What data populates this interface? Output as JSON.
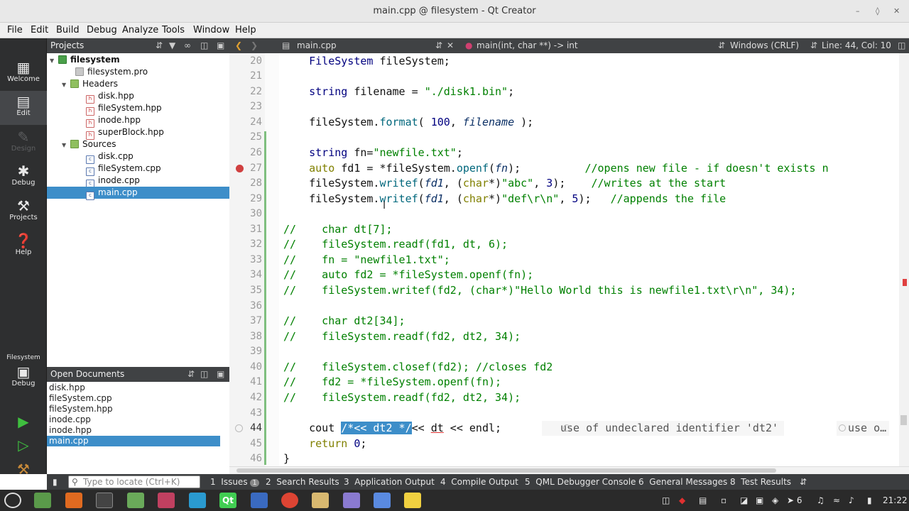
{
  "window": {
    "title": "main.cpp @ filesystem - Qt Creator"
  },
  "menu": [
    "File",
    "Edit",
    "Build",
    "Debug",
    "Analyze",
    "Tools",
    "Window",
    "Help"
  ],
  "modes": [
    {
      "label": "Welcome",
      "icon": "grid-icon"
    },
    {
      "label": "Edit",
      "icon": "edit-icon"
    },
    {
      "label": "Design",
      "icon": "pen-icon"
    },
    {
      "label": "Debug",
      "icon": "bug-icon"
    },
    {
      "label": "Projects",
      "icon": "wrench-icon"
    },
    {
      "label": "Help",
      "icon": "help-icon"
    }
  ],
  "kit": {
    "project": "Filesystem",
    "mode": "Debug"
  },
  "projects_panel": {
    "title": "Projects",
    "tree": [
      {
        "label": "filesystem"
      },
      {
        "label": "filesystem.pro"
      },
      {
        "label": "Headers"
      },
      {
        "label": "disk.hpp"
      },
      {
        "label": "fileSystem.hpp"
      },
      {
        "label": "inode.hpp"
      },
      {
        "label": "superBlock.hpp"
      },
      {
        "label": "Sources"
      },
      {
        "label": "disk.cpp"
      },
      {
        "label": "fileSystem.cpp"
      },
      {
        "label": "inode.cpp"
      },
      {
        "label": "main.cpp"
      }
    ]
  },
  "open_documents": {
    "title": "Open Documents",
    "files": [
      "disk.hpp",
      "fileSystem.cpp",
      "fileSystem.hpp",
      "inode.cpp",
      "inode.hpp",
      "main.cpp"
    ]
  },
  "editor_toolbar": {
    "file": "main.cpp",
    "symbol": "main(int, char **) -> int",
    "line_ending": "Windows (CRLF)",
    "position": "Line: 44, Col: 10"
  },
  "editor": {
    "lines": [
      "20",
      "21",
      "22",
      "23",
      "24",
      "25",
      "26",
      "27",
      "28",
      "29",
      "30",
      "31",
      "32",
      "33",
      "34",
      "35",
      "36",
      "37",
      "38",
      "39",
      "40",
      "41",
      "42",
      "43",
      "44",
      "45",
      "46"
    ],
    "current_line": "44",
    "warnings": [
      "use of undeclared identifier 'dt2'",
      "use o…"
    ]
  },
  "output_panes": {
    "locate_placeholder": "Type to locate (Ctrl+K)",
    "tabs": [
      {
        "num": "1",
        "label": "Issues",
        "badge": "1"
      },
      {
        "num": "2",
        "label": "Search Results"
      },
      {
        "num": "3",
        "label": "Application Output"
      },
      {
        "num": "4",
        "label": "Compile Output"
      },
      {
        "num": "5",
        "label": "QML Debugger Console"
      },
      {
        "num": "6",
        "label": "General Messages"
      },
      {
        "num": "8",
        "label": "Test Results"
      }
    ]
  },
  "taskbar": {
    "clock": "21:22",
    "workspace": "6"
  }
}
